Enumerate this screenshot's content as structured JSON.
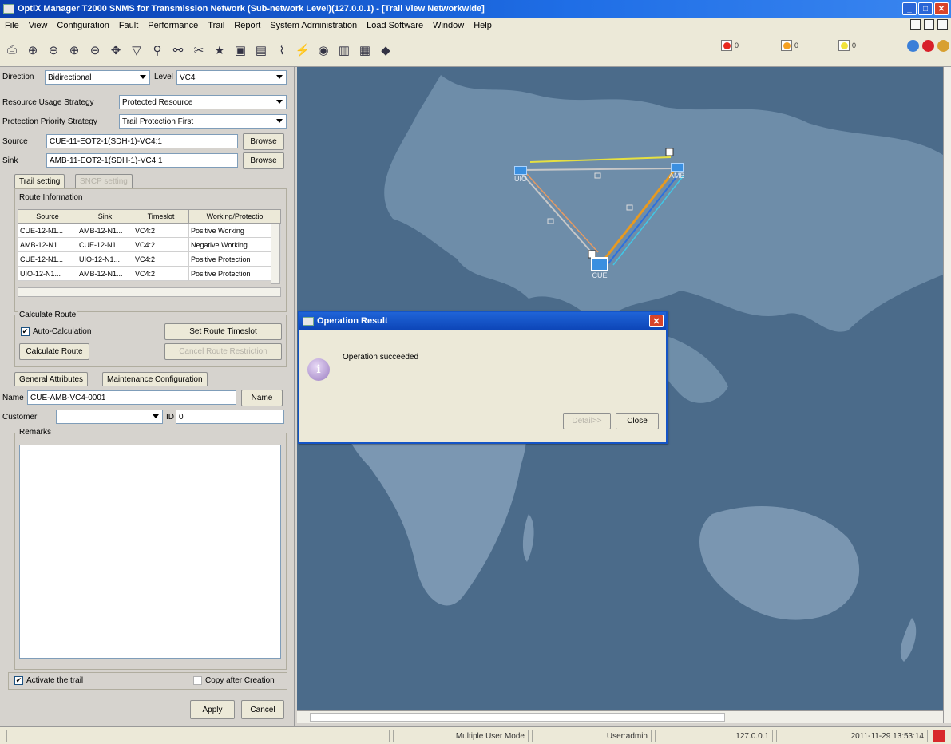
{
  "window": {
    "title": "OptiX Manager T2000 SNMS for Transmission Network (Sub-network Level)(127.0.0.1) - [Trail View Networkwide]"
  },
  "menu": [
    "File",
    "View",
    "Configuration",
    "Fault",
    "Performance",
    "Trail",
    "Report",
    "System Administration",
    "Load Software",
    "Window",
    "Help"
  ],
  "toolbar": {
    "alarm_counts": [
      "0",
      "0",
      "0"
    ],
    "alarm_colors": [
      "#e8281e",
      "#f5a020",
      "#f2e23a"
    ]
  },
  "form": {
    "direction_label": "Direction",
    "direction_value": "Bidirectional",
    "level_label": "Level",
    "level_value": "VC4",
    "resource_label": "Resource Usage Strategy",
    "resource_value": "Protected Resource",
    "protection_label": "Protection Priority Strategy",
    "protection_value": "Trail Protection First",
    "source_label": "Source",
    "source_value": "CUE-11-EOT2-1(SDH-1)-VC4:1",
    "sink_label": "Sink",
    "sink_value": "AMB-11-EOT2-1(SDH-1)-VC4:1",
    "browse_label": "Browse"
  },
  "trail_tabs": [
    "Trail setting",
    "SNCP setting"
  ],
  "route": {
    "title": "Route Information",
    "columns": [
      "Source",
      "Sink",
      "Timeslot",
      "Working/Protectio"
    ],
    "rows": [
      [
        "CUE-12-N1...",
        "AMB-12-N1...",
        "VC4:2",
        "Positive Working"
      ],
      [
        "AMB-12-N1...",
        "CUE-12-N1...",
        "VC4:2",
        "Negative Working"
      ],
      [
        "CUE-12-N1...",
        "UIO-12-N1...",
        "VC4:2",
        "Positive Protection"
      ],
      [
        "UIO-12-N1...",
        "AMB-12-N1...",
        "VC4:2",
        "Positive Protection"
      ]
    ]
  },
  "calc": {
    "title": "Calculate Route",
    "auto_label": "Auto-Calculation",
    "set_timeslot_label": "Set Route Timeslot",
    "calculate_label": "Calculate Route",
    "cancel_restriction_label": "Cancel Route Restriction"
  },
  "attr_tabs": [
    "General Attributes",
    "Maintenance Configuration"
  ],
  "attrs": {
    "name_label": "Name",
    "name_value": "CUE-AMB-VC4-0001",
    "name_button": "Name",
    "customer_label": "Customer",
    "customer_value": "",
    "id_label": "ID",
    "id_value": "0",
    "remarks_label": "Remarks"
  },
  "bottom": {
    "activate_label": "Activate the trail",
    "copy_label": "Copy after Creation",
    "apply_label": "Apply",
    "cancel_label": "Cancel"
  },
  "map": {
    "nodes": [
      "UIO",
      "AMB",
      "CUE"
    ]
  },
  "dialog": {
    "title": "Operation Result",
    "message": "Operation succeeded",
    "detail_label": "Detail>>",
    "close_label": "Close"
  },
  "status": {
    "mode": "Multiple User Mode",
    "user": "User:admin",
    "ip": "127.0.0.1",
    "datetime": "2011-11-29 13:53:14"
  }
}
